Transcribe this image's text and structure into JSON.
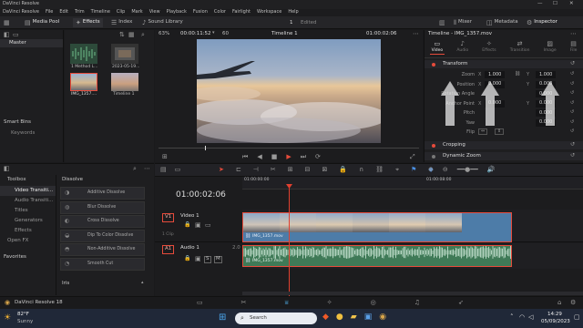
{
  "window": {
    "title": "DaVinci Resolve",
    "controls": [
      "—",
      "☐",
      "✕"
    ]
  },
  "menu": [
    "DaVinci Resolve",
    "File",
    "Edit",
    "Trim",
    "Timeline",
    "Clip",
    "Mark",
    "View",
    "Playback",
    "Fusion",
    "Color",
    "Fairlight",
    "Workspace",
    "Help"
  ],
  "toolbar": {
    "media_pool": "Media Pool",
    "effects": "Effects",
    "index": "Index",
    "sound_library": "Sound Library",
    "project_num": "1",
    "edited": "Edited",
    "mixer": "Mixer",
    "metadata": "Metadata",
    "inspector": "Inspector"
  },
  "viewer": {
    "zoom": "63%",
    "timecode_left": "00:00:11:52",
    "dropdown": "60",
    "timeline_name": "Timeline 1",
    "timecode_right": "01:00:02:06"
  },
  "media_pool": {
    "bin": "Master",
    "smart_bins": "Smart Bins",
    "keywords": "Keywords",
    "clips": [
      {
        "label": "1 Method L...",
        "kind": "audio"
      },
      {
        "label": "2023-05-19...",
        "kind": "video"
      },
      {
        "label": "IMG_1357....",
        "kind": "selected"
      },
      {
        "label": "Timeline 1",
        "kind": "timeline"
      }
    ]
  },
  "inspector": {
    "title": "Timeline - IMG_1357.mov",
    "tabs": [
      "Video",
      "Audio",
      "Effects",
      "Transition",
      "Image",
      "File"
    ],
    "transform": "Transform",
    "rows": [
      {
        "label": "Zoom",
        "a_axis": "X",
        "a": "1.000",
        "b_axis": "Y",
        "b": "1.000"
      },
      {
        "label": "Position",
        "a_axis": "X",
        "a": "0.000",
        "b_axis": "Y",
        "b": "0.000"
      },
      {
        "label": "Rotation Angle",
        "a_axis": "",
        "a": "",
        "b_axis": "",
        "b": "0.000"
      },
      {
        "label": "Anchor Point",
        "a_axis": "X",
        "a": "0.000",
        "b_axis": "Y",
        "b": "0.000"
      },
      {
        "label": "Pitch",
        "a_axis": "",
        "a": "",
        "b_axis": "",
        "b": "0.000"
      },
      {
        "label": "Yaw",
        "a_axis": "",
        "a": "",
        "b_axis": "",
        "b": "0.000"
      },
      {
        "label": "Flip",
        "a_axis": "",
        "a": "",
        "b_axis": "",
        "b": ""
      }
    ],
    "cropping": "Cropping",
    "dynamic_zoom": "Dynamic Zoom"
  },
  "effects": {
    "toolbox": "Toolbox",
    "tree": [
      "Video Transiti...",
      "Audio Transiti...",
      "Titles",
      "Generators",
      "Effects",
      "Open FX"
    ],
    "favorites": "Favorites",
    "category": "Dissolve",
    "items": [
      "Additive Dissolve",
      "Blur Dissolve",
      "Cross Dissolve",
      "Dip To Color Dissolve",
      "Non-Additive Dissolve",
      "Smooth Cut"
    ],
    "next_category": "Iris"
  },
  "timeline": {
    "timecode": "01:00:02:06",
    "ruler": [
      "01:00:00:00",
      "01:00:08:00"
    ],
    "video_track": {
      "id": "V1",
      "name": "Video 1",
      "clip_count": "1 Clip",
      "clip_label": "IMG_1357.mov"
    },
    "audio_track": {
      "id": "A1",
      "name": "Audio 1",
      "level": "2.0",
      "clip_label": "IMG_1357.mov"
    }
  },
  "taskbar": {
    "weather_temp": "82°F",
    "weather_text": "Sunny",
    "search_placeholder": "Search",
    "time": "14:29",
    "date": "05/09/2023"
  },
  "app_footer": {
    "name": "DaVinci Resolve 18"
  },
  "colors": {
    "accent": "#e64b3b",
    "clip_video": "#4d7ca8",
    "clip_audio": "#3f7a57",
    "playhead": "#e2402f"
  }
}
